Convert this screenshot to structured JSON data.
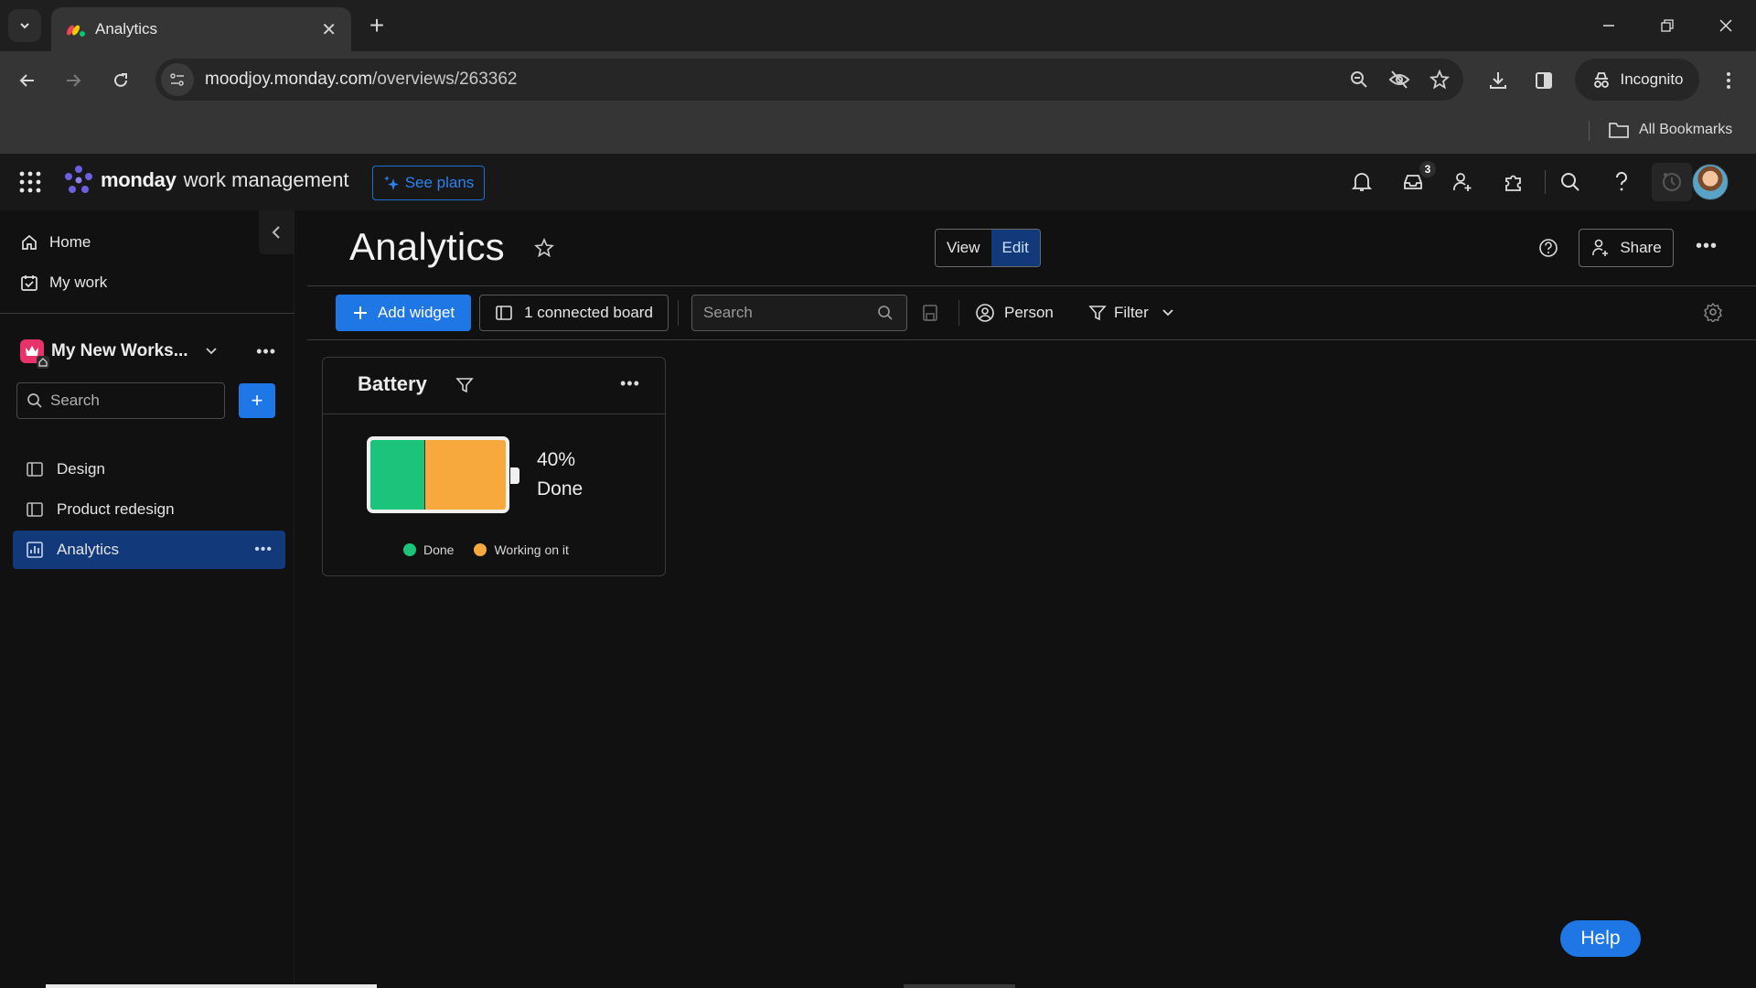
{
  "browser": {
    "tab_title": "Analytics",
    "url_domain": "moodjoy.monday.com",
    "url_path": "/overviews/263362",
    "incognito_label": "Incognito",
    "bookmarks_label": "All Bookmarks"
  },
  "app_header": {
    "brand": "monday",
    "product": "work management",
    "see_plans_label": "See plans",
    "inbox_badge_count": "3"
  },
  "sidebar": {
    "nav": [
      {
        "label": "Home",
        "icon": "home-icon"
      },
      {
        "label": "My work",
        "icon": "calendar-check-icon"
      }
    ],
    "workspace_name": "My New Works...",
    "search_placeholder": "Search",
    "boards": [
      {
        "label": "Design",
        "icon": "board-icon",
        "active": false
      },
      {
        "label": "Product redesign",
        "icon": "board-icon",
        "active": false
      },
      {
        "label": "Analytics",
        "icon": "dashboard-icon",
        "active": true
      }
    ]
  },
  "main": {
    "title": "Analytics",
    "view_label": "View",
    "edit_label": "Edit",
    "share_label": "Share",
    "toolbar": {
      "add_widget_label": "Add widget",
      "connected_boards_label": "1 connected board",
      "search_placeholder": "Search",
      "person_label": "Person",
      "filter_label": "Filter"
    }
  },
  "widget": {
    "title": "Battery",
    "percent_text": "40%",
    "status_text": "Done",
    "segments": [
      {
        "name": "Done",
        "fraction": 0.4,
        "color": "#1cc37a"
      },
      {
        "name": "Working on it",
        "fraction": 0.6,
        "color": "#f7a93e"
      }
    ],
    "legend": [
      {
        "label": "Done",
        "color": "#1cc37a"
      },
      {
        "label": "Working on it",
        "color": "#f7a93e"
      }
    ]
  },
  "help_button_label": "Help",
  "colors": {
    "accent": "#1f76e5",
    "active_item_bg": "#123a7a",
    "workspace_icon": "#e8336a"
  }
}
